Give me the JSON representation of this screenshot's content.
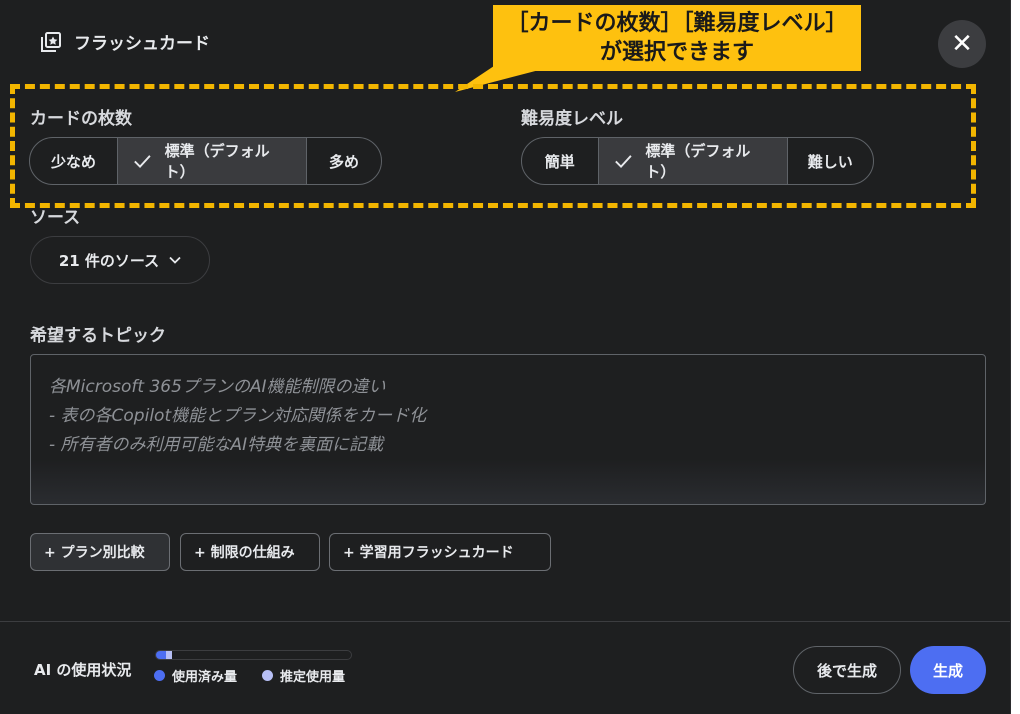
{
  "dialog": {
    "title": "フラッシュカード"
  },
  "close": {
    "label": "✕"
  },
  "card_count": {
    "label": "カードの枚数",
    "options": [
      {
        "label": "少なめ",
        "selected": false
      },
      {
        "label": "標準（デフォルト）",
        "selected": true
      },
      {
        "label": "多め",
        "selected": false
      }
    ]
  },
  "difficulty": {
    "label": "難易度レベル",
    "options": [
      {
        "label": "簡単",
        "selected": false
      },
      {
        "label": "標準（デフォルト）",
        "selected": true
      },
      {
        "label": "難しい",
        "selected": false
      }
    ]
  },
  "sources": {
    "label": "ソース",
    "chip": "21 件のソース"
  },
  "topic": {
    "label": "希望するトピック",
    "placeholder_lines": [
      "各Microsoft 365プランのAI機能制限の違い",
      "- 表の各Copilot機能とプラン対応関係をカード化",
      "- 所有者のみ利用可能なAI特典を裏面に記載"
    ]
  },
  "suggestions": [
    "+ プラン別比較",
    "+ 制限の仕組み",
    "+ 学習用フラッシュカード"
  ],
  "footer": {
    "usage_label": "AI の使用状況",
    "used_label": "使用済み量",
    "estimated_label": "推定使用量",
    "used_fraction": 0.05,
    "estimated_fraction": 0.03,
    "later_button": "後で生成",
    "generate_button": "生成"
  },
  "annotation": {
    "line1": "［カードの枚数］［難易度レベル］",
    "line2": "が選択できます"
  },
  "colors": {
    "accent": "#4d6ef2",
    "estimated": "#b7bff5",
    "callout": "#fec10f",
    "background": "#1e1f20"
  }
}
